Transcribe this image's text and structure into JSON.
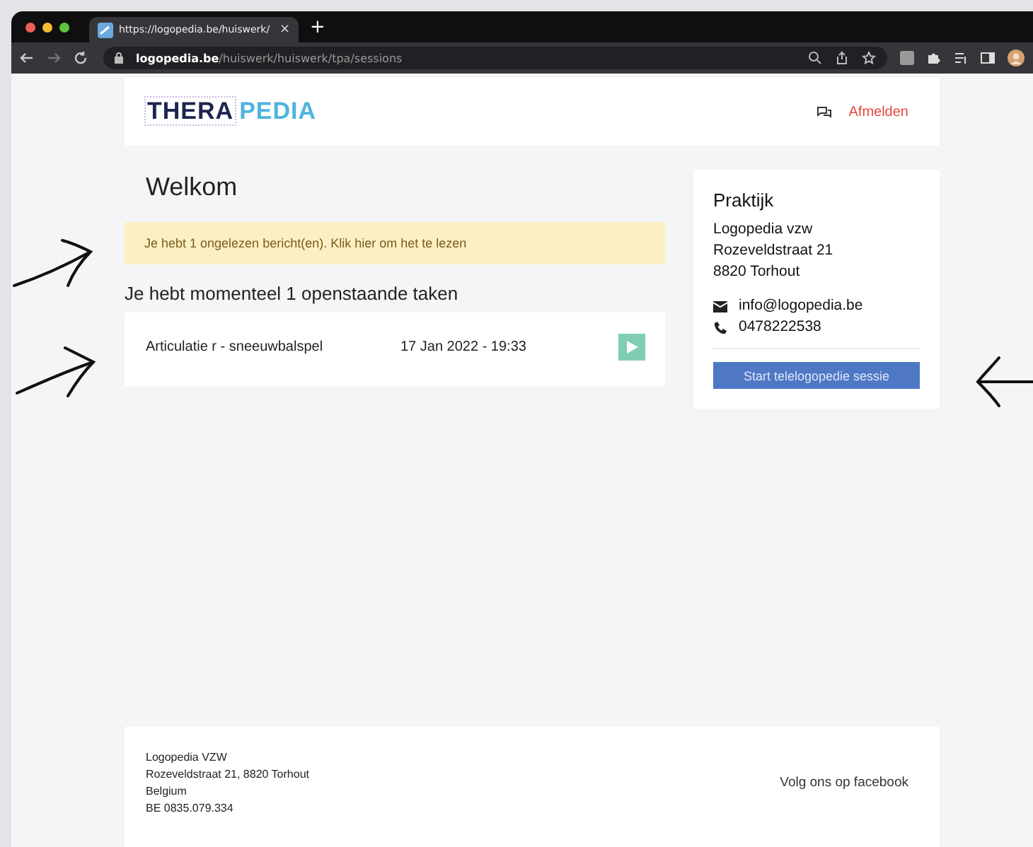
{
  "browser": {
    "tab_title": "https://logopedia.be/huiswerk/",
    "url_host": "logopedia.be",
    "url_path": "/huiswerk/huiswerk/tpa/sessions",
    "new_tab": "+",
    "close": "×"
  },
  "header": {
    "logo_left": "THERA",
    "logo_right": "PEDIA",
    "logout": "Afmelden"
  },
  "main": {
    "title": "Welkom",
    "alert": "Je hebt 1 ongelezen bericht(en). Klik hier om het te lezen",
    "tasks_title": "Je hebt momenteel 1 openstaande taken",
    "tasks": [
      {
        "name": "Articulatie r - sneeuwbalspel",
        "date": "17 Jan 2022 - 19:33"
      }
    ]
  },
  "practice": {
    "title": "Praktijk",
    "address": [
      "Logopedia vzw",
      "Rozeveldstraat 21",
      "8820 Torhout"
    ],
    "email": "info@logopedia.be",
    "phone": "0478222538",
    "button": "Start telelogopedie sessie"
  },
  "footer": {
    "lines": [
      "Logopedia VZW",
      "Rozeveldstraat 21, 8820 Torhout",
      "Belgium",
      "BE 0835.079.334"
    ],
    "social": "Volg ons op facebook"
  }
}
